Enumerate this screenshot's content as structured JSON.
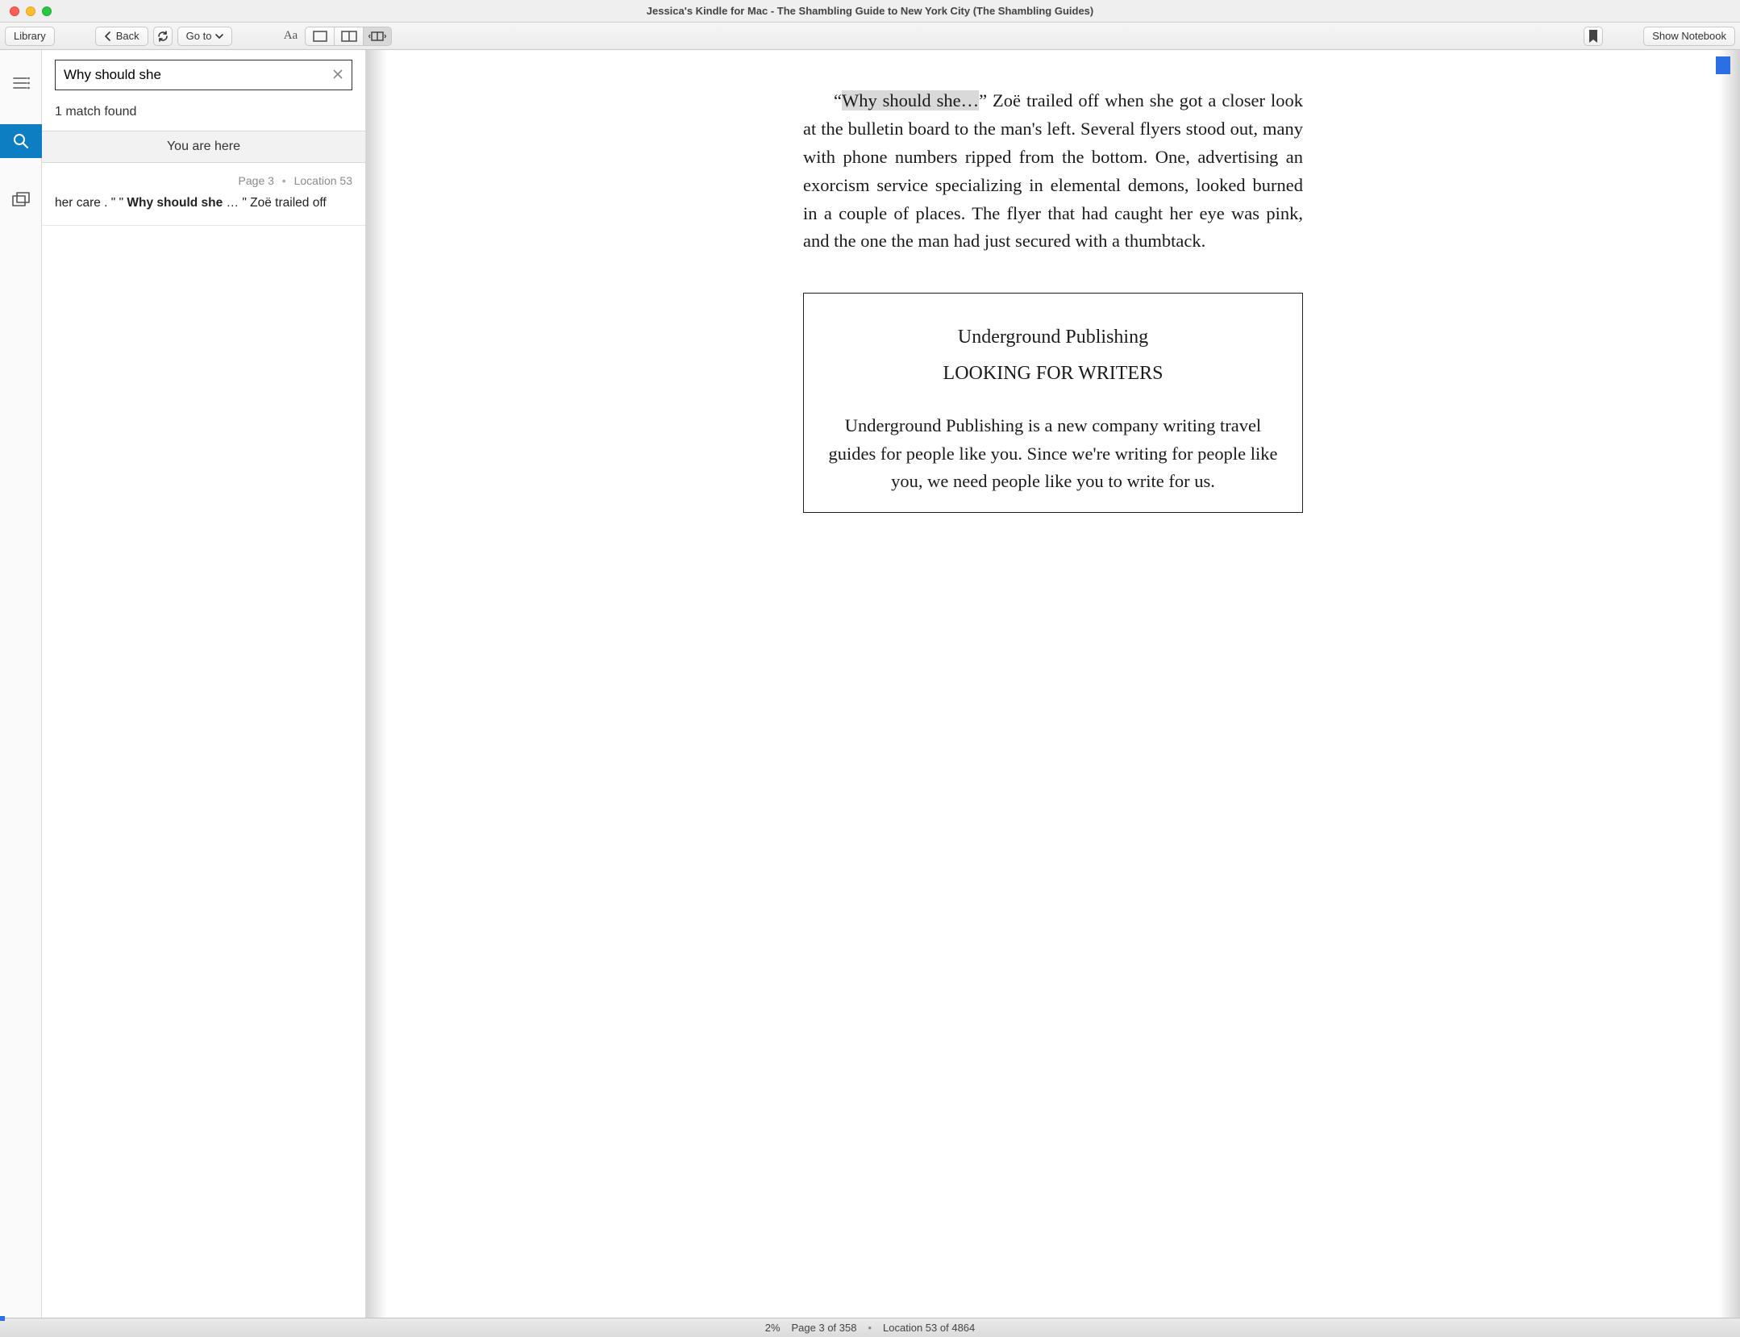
{
  "window": {
    "title": "Jessica's Kindle for Mac - The Shambling Guide to New York City (The Shambling Guides)"
  },
  "toolbar": {
    "library": "Library",
    "back": "Back",
    "goto": "Go to",
    "show_notebook": "Show Notebook"
  },
  "search": {
    "query": "Why should she",
    "match_count": "1 match found",
    "you_are_here": "You are here",
    "result": {
      "page_label": "Page 3",
      "location_label": "Location 53",
      "pre": "her care . \" \" ",
      "match": "Why should she",
      "post": " … \" Zoë trailed off"
    }
  },
  "reader": {
    "quote_open": "“",
    "highlight": "Why should she…",
    "para_rest": "” Zoë trailed off when she got a closer look at the bulletin board to the man's left. Several flyers stood out, many with phone numbers ripped from the bottom. One, advertising an exorcism service specializing in elemental demons, looked burned in a couple of places. The flyer that had caught her eye was pink, and the one the man had just secured with a thumbtack.",
    "flyer": {
      "line1": "Underground Publishing",
      "line2": "LOOKING FOR WRITERS",
      "body": "Underground Publishing is a new company writing travel guides for people like you. Since we're writing for people like you, we need people like you to write for us."
    }
  },
  "status": {
    "percent": "2%",
    "page": "Page 3 of 358",
    "location": "Location 53 of 4864"
  }
}
